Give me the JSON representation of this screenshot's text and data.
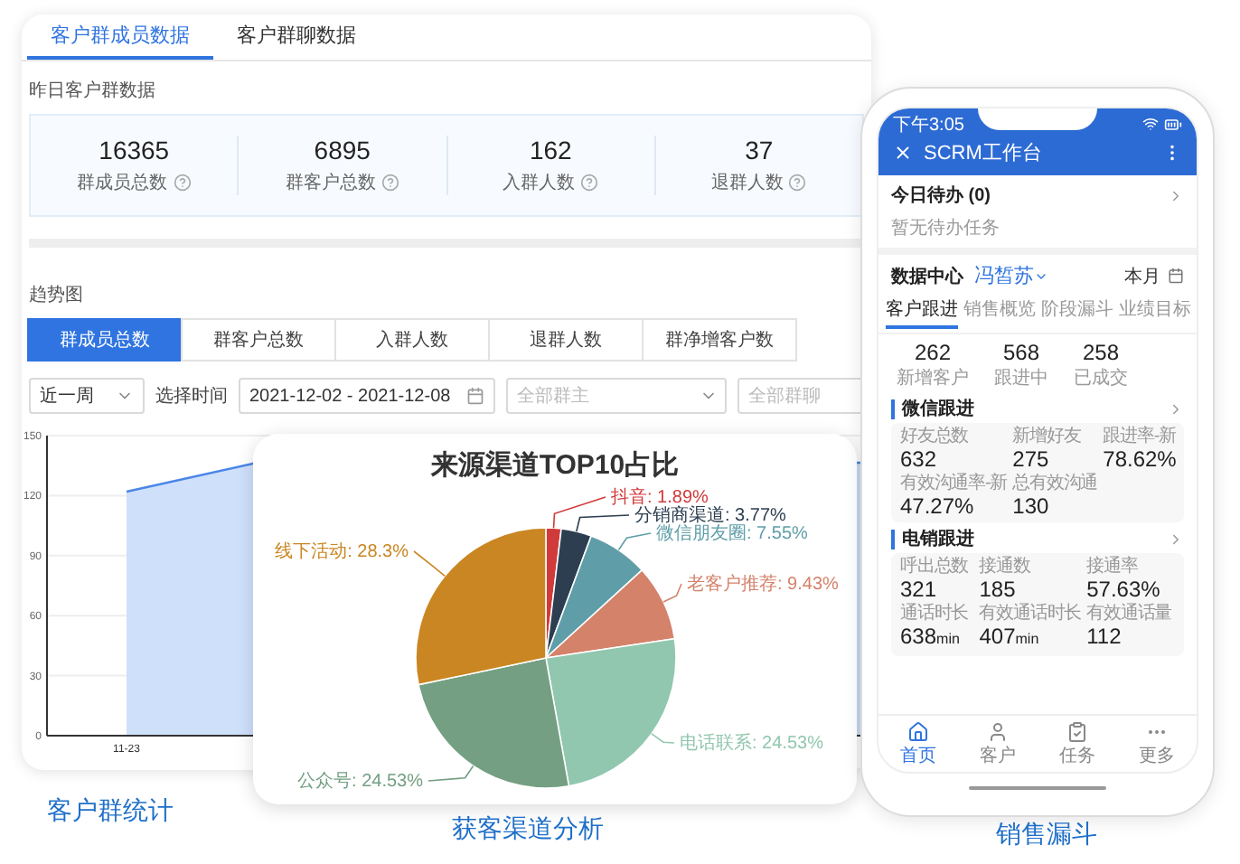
{
  "main_panel": {
    "tabs": [
      {
        "label": "客户群成员数据",
        "selected": true
      },
      {
        "label": "客户群聊数据",
        "selected": false
      }
    ],
    "yesterday_title": "昨日客户群数据",
    "stats": [
      {
        "value": "16365",
        "label": "群成员总数"
      },
      {
        "value": "6895",
        "label": "群客户总数"
      },
      {
        "value": "162",
        "label": "入群人数"
      },
      {
        "value": "37",
        "label": "退群人数"
      }
    ],
    "trend_title": "趋势图",
    "metric_tabs": [
      {
        "label": "群成员总数",
        "selected": true
      },
      {
        "label": "群客户总数",
        "selected": false
      },
      {
        "label": "入群人数",
        "selected": false
      },
      {
        "label": "退群人数",
        "selected": false
      },
      {
        "label": "群净增客户数",
        "selected": false
      }
    ],
    "filters": {
      "period": "近一周",
      "time_label": "选择时间",
      "date_range": "2021-12-02 - 2021-12-08",
      "owner_placeholder": "全部群主",
      "group_placeholder": "全部群聊"
    },
    "trend_chart": {
      "y_labels": [
        "150",
        "120",
        "90",
        "60",
        "30",
        "0"
      ],
      "x_labels": [
        "11-23"
      ]
    }
  },
  "pie_card": {
    "chart_data": {
      "type": "pie",
      "title": "来源渠道TOP10占比",
      "categories": [
        "抖音",
        "分销商渠道",
        "微信朋友圈",
        "老客户推荐",
        "电话联系",
        "公众号",
        "线下活动"
      ],
      "values": [
        1.89,
        3.77,
        7.55,
        9.43,
        24.53,
        24.53,
        28.3
      ],
      "colors": [
        "#d13a3a",
        "#2c3e50",
        "#5f9ea8",
        "#d4826a",
        "#91c7ae",
        "#749f83",
        "#ca8622"
      ],
      "value_labels": [
        "1.89%",
        "3.77%",
        "7.55%",
        "9.43%",
        "24.53%",
        "24.53%",
        "28.3%"
      ]
    }
  },
  "phone": {
    "status_time": "下午3:05",
    "title": "SCRM工作台",
    "todo": {
      "title": "今日待办 (0)",
      "empty": "暂无待办任务"
    },
    "data_center": {
      "title": "数据中心",
      "person": "冯皙苏",
      "period": "本月"
    },
    "tabs": [
      {
        "label": "客户跟进",
        "selected": true
      },
      {
        "label": "销售概览",
        "selected": false
      },
      {
        "label": "阶段漏斗",
        "selected": false
      },
      {
        "label": "业绩目标",
        "selected": false
      }
    ],
    "summary": [
      {
        "value": "262",
        "label": "新增客户"
      },
      {
        "value": "568",
        "label": "跟进中"
      },
      {
        "value": "258",
        "label": "已成交"
      }
    ],
    "sections": [
      {
        "title": "微信跟进",
        "metrics": [
          {
            "label": "好友总数",
            "value": "632"
          },
          {
            "label": "新增好友",
            "value": "275"
          },
          {
            "label": "跟进率-新",
            "value": "78.62%"
          },
          {
            "label": "有效沟通率-新",
            "value": "47.27%"
          },
          {
            "label": "总有效沟通",
            "value": "130"
          }
        ]
      },
      {
        "title": "电销跟进",
        "metrics": [
          {
            "label": "呼出总数",
            "value": "321"
          },
          {
            "label": "接通数",
            "value": "185"
          },
          {
            "label": "接通率",
            "value": "57.63%"
          },
          {
            "label": "通话时长",
            "value": "638",
            "unit": "min"
          },
          {
            "label": "有效通话时长",
            "value": "407",
            "unit": "min"
          },
          {
            "label": "有效通话量",
            "value": "112"
          }
        ]
      }
    ],
    "nav": [
      {
        "label": "首页",
        "kind": "home",
        "selected": true
      },
      {
        "label": "客户",
        "kind": "person",
        "selected": false
      },
      {
        "label": "任务",
        "kind": "task",
        "selected": false
      },
      {
        "label": "更多",
        "kind": "more",
        "selected": false
      }
    ]
  },
  "captions": [
    "客户群统计",
    "获客渠道分析",
    "销售漏斗"
  ]
}
